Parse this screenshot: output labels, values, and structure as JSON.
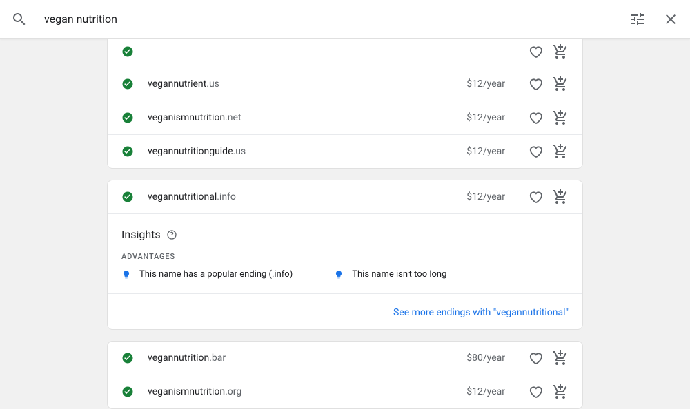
{
  "search": {
    "value": "vegan nutrition"
  },
  "group1": {
    "rows": [
      {
        "name": "vegannutrient",
        "tld": ".us",
        "price": "$12/year"
      },
      {
        "name": "veganismnutrition",
        "tld": ".net",
        "price": "$12/year"
      },
      {
        "name": "vegannutritionguide",
        "tld": ".us",
        "price": "$12/year"
      }
    ]
  },
  "featured": {
    "name": "vegannutritional",
    "tld": ".info",
    "price": "$12/year",
    "insights_title": "Insights",
    "advantages_label": "Advantages",
    "adv1": "This name has a popular ending (.info)",
    "adv2": "This name isn't too long",
    "see_more": "See more endings with \"vegannutritional\""
  },
  "group2": {
    "rows": [
      {
        "name": "vegannutrition",
        "tld": ".bar",
        "price": "$80/year"
      },
      {
        "name": "veganismnutrition",
        "tld": ".org",
        "price": "$12/year"
      }
    ]
  }
}
